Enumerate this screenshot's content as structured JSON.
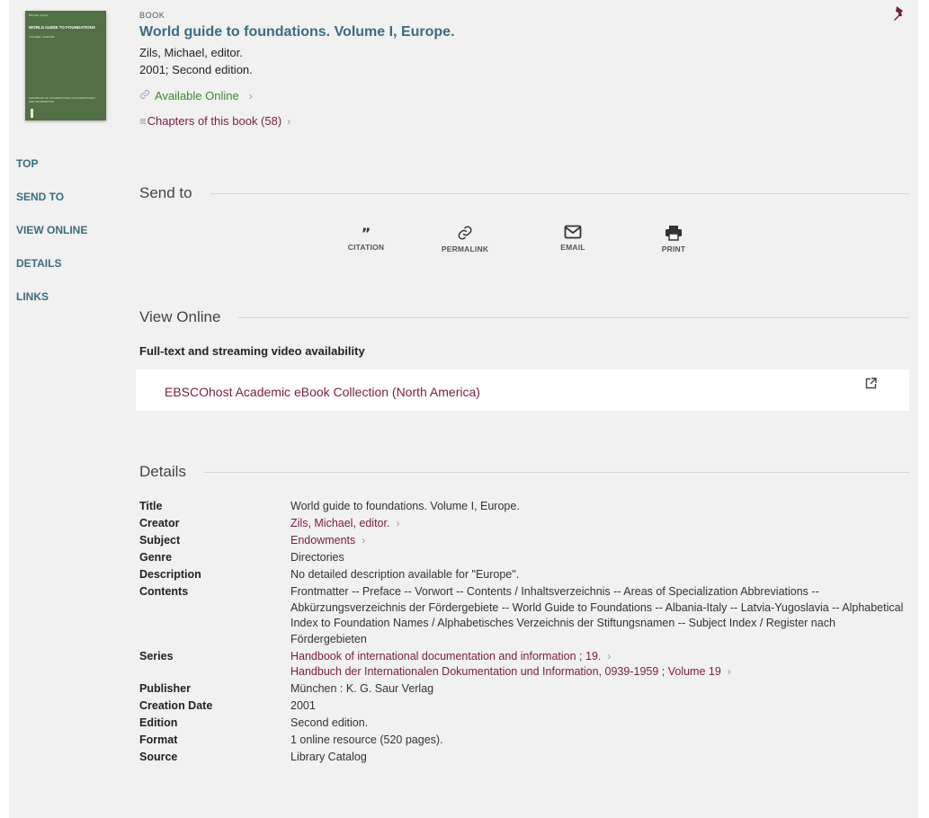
{
  "record": {
    "type_label": "BOOK",
    "title": "World guide to foundations. Volume I, Europe.",
    "author": "Zils, Michael, editor.",
    "date_edition": "2001; Second edition.",
    "availability": "Available Online",
    "chapters": "Chapters of this book (58)",
    "cover": {
      "top_text": "BRAND SAUR",
      "title_text": "WORLD GUIDE TO FOUNDATIONS",
      "sub_text": "VOLUME I: EUROPE",
      "bottom_text": "HANDBOOK OF INTERNATIONAL DOCUMENTATION AND INFORMATION"
    }
  },
  "nav": [
    "TOP",
    "SEND TO",
    "VIEW ONLINE",
    "DETAILS",
    "LINKS"
  ],
  "send_to": {
    "heading": "Send to",
    "items": [
      {
        "label": "CITATION",
        "icon": "quote-icon"
      },
      {
        "label": "PERMALINK",
        "icon": "link-icon"
      },
      {
        "label": "EMAIL",
        "icon": "envelope-icon"
      },
      {
        "label": "PRINT",
        "icon": "printer-icon"
      }
    ]
  },
  "view_online": {
    "heading": "View Online",
    "availability_label": "Full-text and streaming video availability",
    "link_text": "EBSCOhost Academic eBook Collection (North America)"
  },
  "details": {
    "heading": "Details",
    "title_label": "Title",
    "title_value": "World guide to foundations. Volume I, Europe.",
    "creator_label": "Creator",
    "creator_value": "Zils, Michael, editor.",
    "subject_label": "Subject",
    "subject_value": "Endowments",
    "genre_label": "Genre",
    "genre_value": "Directories",
    "description_label": "Description",
    "description_value": "No detailed description available for \"Europe\".",
    "contents_label": "Contents",
    "contents_value": "Frontmatter -- Preface -- Vorwort -- Contents / Inhaltsverzeichnis -- Areas of Specialization Abbreviations -- Abkürzungsverzeichnis der Fördergebiete -- World Guide to Foundations -- Albania-Italy -- Latvia-Yugoslavia -- Alphabetical Index to Foundation Names / Alphabetisches Verzeichnis der Stiftungsnamen -- Subject Index / Register nach Fördergebieten",
    "series_label": "Series",
    "series_value_1": "Handbook of international documentation and information ; 19.",
    "series_value_2": "Handbuch der Internationalen Dokumentation und Information, 0939-1959 ; Volume 19",
    "publisher_label": "Publisher",
    "publisher_value": "München : K. G. Saur Verlag",
    "creation_date_label": "Creation Date",
    "creation_date_value": "2001",
    "edition_label": "Edition",
    "edition_value": "Second edition.",
    "format_label": "Format",
    "format_value": "1 online resource (520 pages).",
    "source_label": "Source",
    "source_value": "Library Catalog"
  },
  "colors": {
    "title_link": "#3d6b80",
    "maroon_link": "#7a1e3a",
    "available_green": "#3b8a2c",
    "page_bg": "#f1f1f1",
    "cover_green": "#526f45"
  }
}
